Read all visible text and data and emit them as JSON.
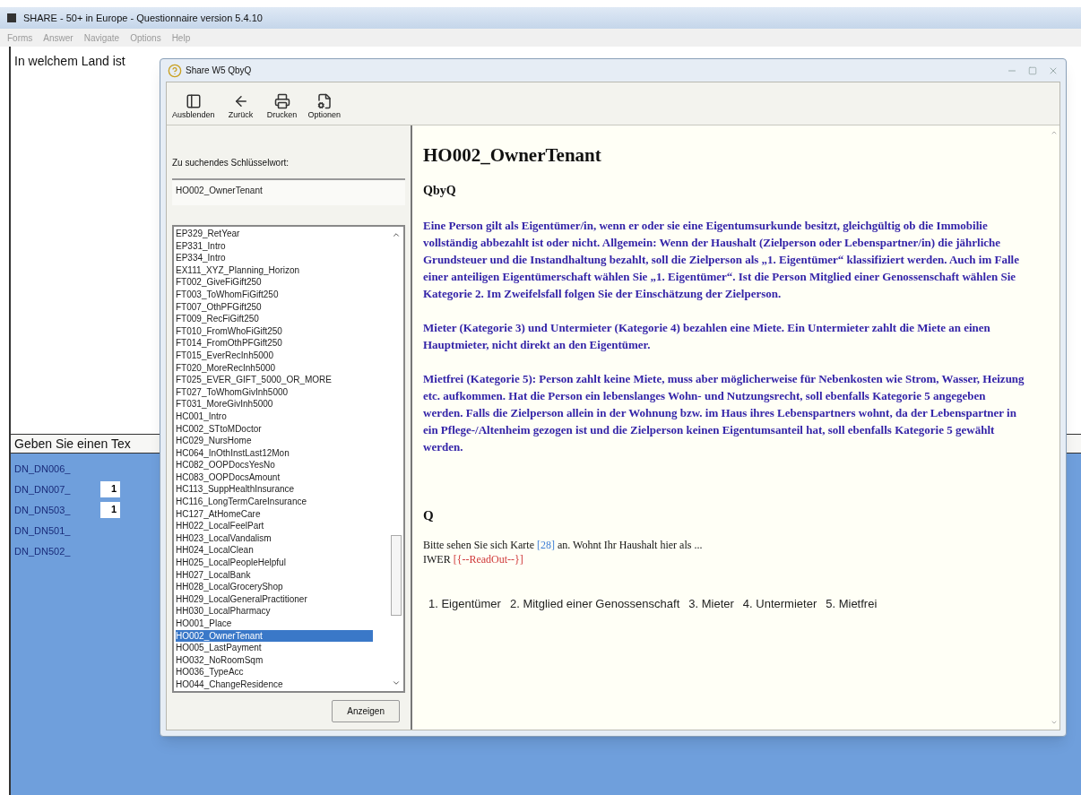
{
  "main_window": {
    "title": "SHARE - 50+ in Europe - Questionnaire version 5.4.10",
    "menu": [
      "Forms",
      "Answer",
      "Navigate",
      "Options",
      "Help"
    ],
    "question_text": "In welchem Land ist",
    "input_prompt": "Geben Sie einen Tex",
    "fields": [
      {
        "label": "DN_DN006_"
      },
      {
        "label": "DN_DN007_",
        "value": "1"
      },
      {
        "label": "DN_DN503_",
        "value": "1"
      },
      {
        "label": "DN_DN501_"
      },
      {
        "label": "DN_DN502_"
      }
    ]
  },
  "dialog": {
    "title": "Share W5 QbyQ",
    "toolbar": [
      {
        "label": "Ausblenden",
        "kind": "hide"
      },
      {
        "label": "Zurück",
        "kind": "back"
      },
      {
        "label": "Drucken",
        "kind": "print"
      },
      {
        "label": "Optionen",
        "kind": "options"
      }
    ],
    "search": {
      "label": "Zu suchendes Schlüsselwort:",
      "value": "HO002_OwnerTenant"
    },
    "list": [
      {
        "label": "EP329_RetYear",
        "selected": false
      },
      {
        "label": "EP331_Intro",
        "selected": false
      },
      {
        "label": "EP334_Intro",
        "selected": false
      },
      {
        "label": "EX111_XYZ_Planning_Horizon",
        "selected": false
      },
      {
        "label": "FT002_GiveFiGift250",
        "selected": false
      },
      {
        "label": "FT003_ToWhomFiGift250",
        "selected": false
      },
      {
        "label": "FT007_OthPFGift250",
        "selected": false
      },
      {
        "label": "FT009_RecFiGift250",
        "selected": false
      },
      {
        "label": "FT010_FromWhoFiGift250",
        "selected": false
      },
      {
        "label": "FT014_FromOthPFGift250",
        "selected": false
      },
      {
        "label": "FT015_EverRecInh5000",
        "selected": false
      },
      {
        "label": "FT020_MoreRecInh5000",
        "selected": false
      },
      {
        "label": "FT025_EVER_GIFT_5000_OR_MORE",
        "selected": false
      },
      {
        "label": "FT027_ToWhomGivInh5000",
        "selected": false
      },
      {
        "label": "FT031_MoreGivInh5000",
        "selected": false
      },
      {
        "label": "HC001_Intro",
        "selected": false
      },
      {
        "label": "HC002_STtoMDoctor",
        "selected": false
      },
      {
        "label": "HC029_NursHome",
        "selected": false
      },
      {
        "label": "HC064_InOthInstLast12Mon",
        "selected": false
      },
      {
        "label": "HC082_OOPDocsYesNo",
        "selected": false
      },
      {
        "label": "HC083_OOPDocsAmount",
        "selected": false
      },
      {
        "label": "HC113_SuppHealthInsurance",
        "selected": false
      },
      {
        "label": "HC116_LongTermCareInsurance",
        "selected": false
      },
      {
        "label": "HC127_AtHomeCare",
        "selected": false
      },
      {
        "label": "HH022_LocalFeelPart",
        "selected": false
      },
      {
        "label": "HH023_LocalVandalism",
        "selected": false
      },
      {
        "label": "HH024_LocalClean",
        "selected": false
      },
      {
        "label": "HH025_LocalPeopleHelpful",
        "selected": false
      },
      {
        "label": "HH027_LocalBank",
        "selected": false
      },
      {
        "label": "HH028_LocalGroceryShop",
        "selected": false
      },
      {
        "label": "HH029_LocalGeneralPractitioner",
        "selected": false
      },
      {
        "label": "HH030_LocalPharmacy",
        "selected": false
      },
      {
        "label": "HO001_Place",
        "selected": false
      },
      {
        "label": "HO002_OwnerTenant",
        "selected": true
      },
      {
        "label": "HO005_LastPayment",
        "selected": false
      },
      {
        "label": "HO032_NoRoomSqm",
        "selected": false
      },
      {
        "label": "HO036_TypeAcc",
        "selected": false
      },
      {
        "label": "HO044_ChangeResidence",
        "selected": false
      }
    ],
    "show_button": "Anzeigen",
    "content": {
      "heading": "HO002_OwnerTenant",
      "subheading": "QbyQ",
      "notes": [
        "Eine Person gilt als Eigentümer/in, wenn er oder sie eine Eigentumsurkunde besitzt, gleichgültig ob die Immobilie vollständig abbezahlt ist oder nicht. Allgemein: Wenn der Haushalt (Zielperson oder Lebenspartner/in) die jährliche Grundsteuer und die Instandhaltung bezahlt, soll die Zielperson als „1. Eigentümer“ klassifiziert werden. Auch im Falle einer anteiligen Eigentümerschaft wählen Sie „1. Eigentümer“. Ist die Person Mitglied einer Genossenschaft wählen Sie Kategorie 2. Im Zweifelsfall folgen Sie der Einschätzung der Zielperson.",
        "Mieter (Kategorie 3) und Untermieter (Kategorie 4) bezahlen eine Miete. Ein Untermieter zahlt die Miete an einen Hauptmieter, nicht direkt an den Eigentümer.",
        "Mietfrei (Kategorie 5): Person zahlt keine Miete, muss aber möglicherweise für Nebenkosten wie Strom, Wasser, Heizung etc. aufkommen. Hat die Person ein lebenslanges Wohn- und Nutzungsrecht, soll ebenfalls Kategorie 5 angegeben werden. Falls die Zielperson allein in der Wohnung bzw. im Haus ihres Lebenspartners wohnt, da der Lebenspartner in ein Pflege-/Altenheim gezogen ist und die Zielperson keinen Eigentumsanteil hat, soll ebenfalls Kategorie 5 gewählt werden."
      ],
      "section": "Q",
      "question_lines": [
        [
          {
            "text": "Bitte sehen Sie sich Karte ",
            "kind": "plain"
          },
          {
            "text": "[28]",
            "kind": "reference"
          },
          {
            "text": " an. Wohnt Ihr Haushalt hier als ...",
            "kind": "plain"
          }
        ],
        [
          {
            "text": "IWER ",
            "kind": "plain"
          },
          {
            "text": "[{--ReadOut--}]",
            "kind": "instruction"
          }
        ]
      ],
      "options": [
        "1. Eigentümer",
        "2. Mitglied einer Genossenschaft",
        "3. Mieter",
        "4. Untermieter",
        "5. Mietfrei"
      ]
    }
  }
}
